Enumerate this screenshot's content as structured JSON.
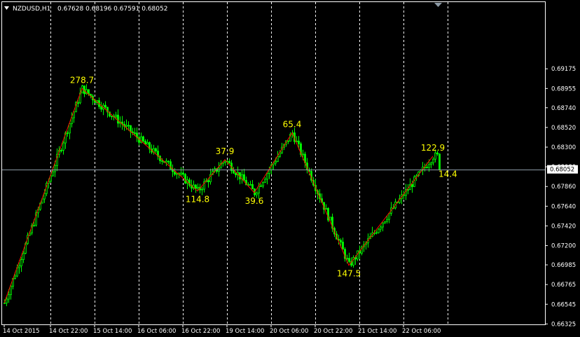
{
  "header": {
    "symbol_timeframe": "NZDUSD,H1",
    "ohlc": "0.67628 0.68196 0.67591 0.68052"
  },
  "colors": {
    "background": "#000000",
    "candles": "#00ff00",
    "grid": "#ffffff",
    "zigzag": "#ff0000",
    "labels": "#ffff00",
    "price_line": "#8c9aa6"
  },
  "chart_data": {
    "type": "candlestick",
    "symbol": "NZDUSD",
    "timeframe": "H1",
    "current_price": "0.68052",
    "ylim": [
      0.6632,
      0.6992
    ],
    "y_ticks": [
      "0.69175",
      "0.68955",
      "0.68740",
      "0.68520",
      "0.68300",
      "0.68080",
      "0.67860",
      "0.67640",
      "0.67420",
      "0.67200",
      "0.66985",
      "0.66765",
      "0.66545",
      "0.66325"
    ],
    "x_ticks": [
      "14 Oct 2015",
      "14 Oct 22:00",
      "15 Oct 14:00",
      "16 Oct 06:00",
      "16 Oct 22:00",
      "19 Oct 14:00",
      "20 Oct 06:00",
      "20 Oct 22:00",
      "21 Oct 14:00",
      "22 Oct 06:00"
    ],
    "bar_range": [
      0,
      207
    ],
    "x_tick_bars": [
      0,
      22,
      43,
      64,
      85,
      106,
      127,
      148,
      169,
      190
    ],
    "grid_bars": [
      22,
      43,
      64,
      85,
      106,
      127,
      148,
      169,
      190,
      211
    ],
    "zigzag": [
      {
        "bar": 0,
        "price": 0.6656,
        "label": ""
      },
      {
        "bar": 37,
        "price": 0.68955,
        "label": "278.7"
      },
      {
        "bar": 92,
        "price": 0.6781,
        "label": "114.8"
      },
      {
        "bar": 105,
        "price": 0.6816,
        "label": "37.9"
      },
      {
        "bar": 119,
        "price": 0.6779,
        "label": "39.6"
      },
      {
        "bar": 137,
        "price": 0.6846,
        "label": "65.4"
      },
      {
        "bar": 164,
        "price": 0.6698,
        "label": "147.5"
      },
      {
        "bar": 204,
        "price": 0.682,
        "label": "122.9"
      }
    ],
    "last_segment_label": "14.4"
  }
}
